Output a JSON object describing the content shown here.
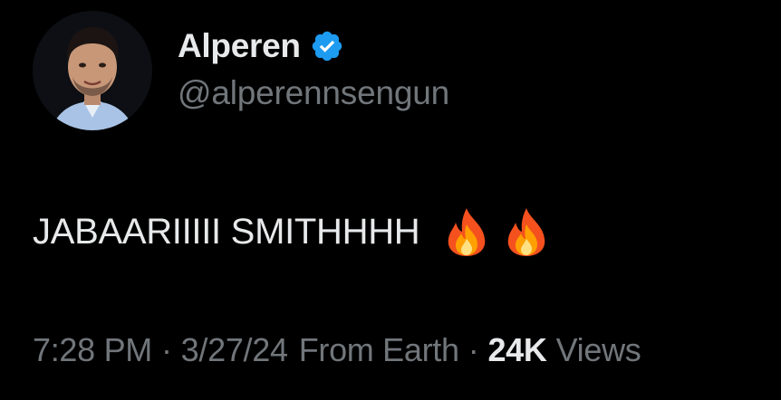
{
  "author": {
    "display_name": "Alperen",
    "handle": "@alperennsengun",
    "verified": true,
    "verified_color": "#1d9bf0"
  },
  "tweet": {
    "text": "JABAARIIIII SMITHHHH",
    "emoji": [
      "fire-emoji",
      "fire-emoji"
    ]
  },
  "meta": {
    "time": "7:28 PM",
    "separator": "·",
    "date": "3/27/24",
    "source": "From Earth",
    "views_count": "24K",
    "views_label": "Views"
  },
  "colors": {
    "background": "#000000",
    "primary_text": "#e7e9ea",
    "secondary_text": "#71767b"
  }
}
